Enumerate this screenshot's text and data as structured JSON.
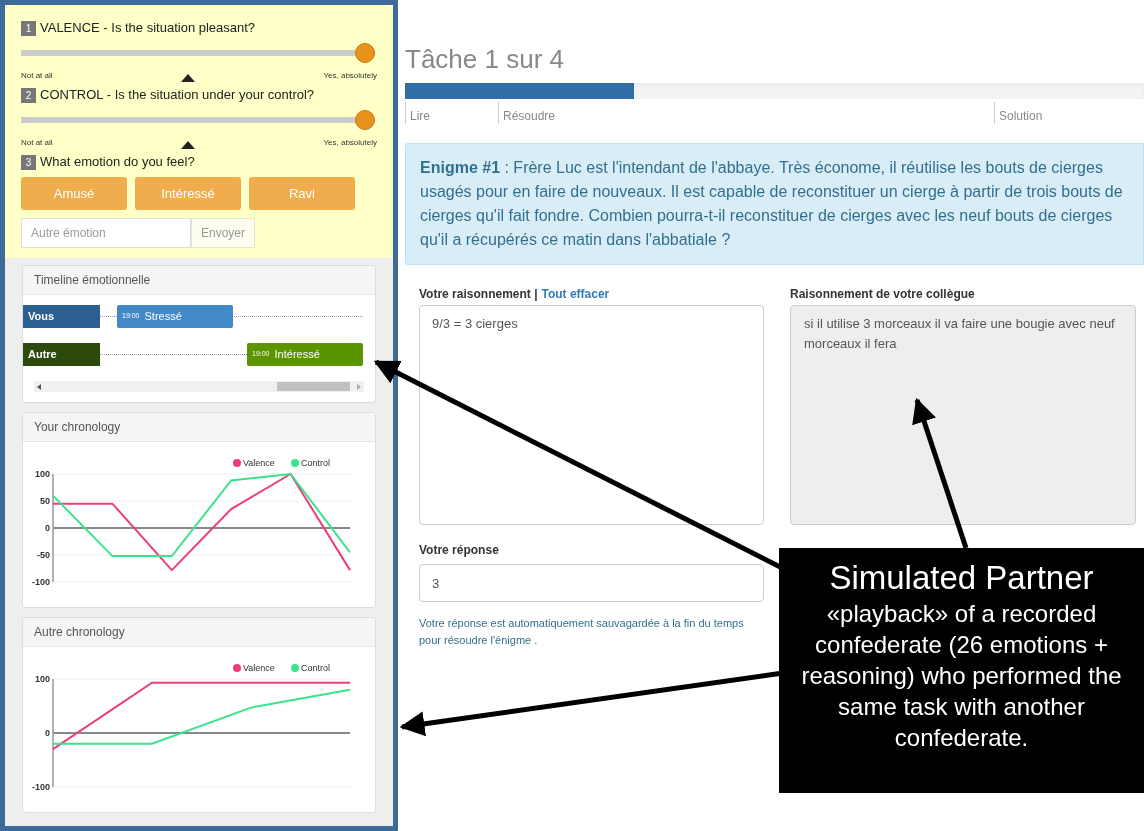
{
  "sidebar": {
    "questions": [
      {
        "number": "1",
        "kind": "slider",
        "label": "VALENCE - Is the situation pleasant?",
        "level": 1,
        "min_label": "Not at all",
        "max_label": "Yes, absolutely"
      },
      {
        "number": "2",
        "kind": "slider",
        "label": "CONTROL - Is the situation under your control?",
        "level": 1,
        "min_label": "Not at all",
        "max_label": "Yes, absolutely"
      },
      {
        "number": "3",
        "kind": "choice",
        "label": "What emotion do you feel?",
        "options": [
          "Amusé",
          "Intéressé",
          "Ravi"
        ],
        "other_placeholder": "Autre émotion",
        "send_label": "Envoyer"
      }
    ],
    "timeline": {
      "title": "Timeline émotionnelle",
      "rows": [
        {
          "name": "Vous",
          "color": "#2c5f91",
          "event": {
            "time": "19:00",
            "label": "Stressé",
            "color": "#4189c7"
          }
        },
        {
          "name": "Autre",
          "color": "#2b4a0b",
          "event": {
            "time": "19:00",
            "label": "Intéressé",
            "color": "#5a9400"
          }
        }
      ]
    },
    "charts": [
      {
        "title": "Your chronology",
        "chart_data": {
          "type": "line",
          "legend": "top-right",
          "ylim": [
            -100,
            100
          ],
          "yticks": [
            100,
            50,
            0,
            -50,
            -100
          ],
          "series": [
            {
              "name": "Valence",
              "color": "#ee3c7a",
              "values": [
                45,
                45,
                -78,
                35,
                100,
                -78
              ]
            },
            {
              "name": "Control",
              "color": "#3ae48c",
              "values": [
                60,
                -52,
                -52,
                88,
                100,
                -45
              ]
            }
          ]
        }
      },
      {
        "title": "Autre chronology",
        "chart_data": {
          "type": "line",
          "legend": "top-right",
          "ylim": [
            -100,
            100
          ],
          "yticks": [
            100,
            0,
            -100
          ],
          "series": [
            {
              "name": "Valence",
              "color": "#ee3c7a",
              "values": [
                -30,
                93,
                93,
                93
              ]
            },
            {
              "name": "Control",
              "color": "#3ae48c",
              "values": [
                -20,
                -20,
                47,
                80
              ]
            }
          ]
        }
      }
    ]
  },
  "task": {
    "title": "Tâche 1 sur 4",
    "progress": {
      "level": 0.31
    },
    "steps": [
      {
        "label": "Lire"
      },
      {
        "label": "Résoudre"
      },
      {
        "label": "Solution"
      }
    ],
    "riddle": "**Enigme #1** : Frère Luc est l'intendant de l'abbaye. Très économe, il réutilise les bouts de cierges usagés pour en faire de nouveaux. Il est capable de reconstituer un cierge à partir de trois bouts de cierges qu'il fait fondre. Combien pourra-t-il reconstituer de cierges avec les neuf bouts de cierges qu'il a récupérés ce matin dans l'abbatiale ?",
    "own": {
      "label": "Votre raisonnement |",
      "clear_link": "Tout effacer",
      "value": "9/3 = 3 cierges"
    },
    "partner": {
      "label": "Raisonnement de votre collègue",
      "value": "si il utilise 3 morceaux il va faire une bougie avec neuf morceaux il fera"
    },
    "answer": {
      "label": "Votre réponse",
      "value": "3"
    },
    "note": "Votre réponse est automatiquement sauvagardée à la fin du temps pour résoudre l'énigme ."
  },
  "annotation": {
    "title": "Simulated Partner",
    "text": "«playback» of a recorded confederate (26 emotions + reasoning) who performed the same task with another confederate."
  }
}
